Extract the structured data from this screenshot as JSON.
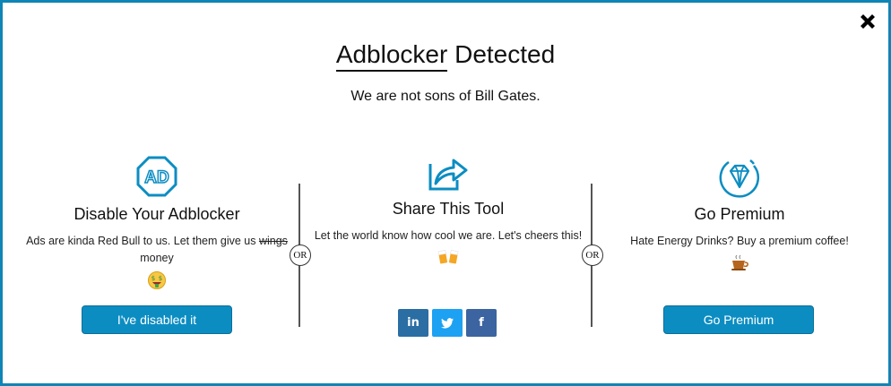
{
  "modal": {
    "title_part1": "Adblocker",
    "title_part2": " Detected",
    "subtitle": "We are not sons of Bill Gates."
  },
  "columns": [
    {
      "heading": "Disable Your Adblocker",
      "text_before": "Ads are kinda Red Bull to us. Let them give us ",
      "text_strike": "wings",
      "text_after": " money",
      "button_label": "I've disabled it",
      "icon": "ad-icon",
      "emoji": "money-face-emoji"
    },
    {
      "heading": "Share This Tool",
      "text": "Let the world know how cool we are. Let's cheers this!",
      "icon": "share-icon",
      "emoji": "beer-cheers-emoji",
      "social": [
        "in",
        "t",
        "f"
      ]
    },
    {
      "heading": "Go Premium",
      "text": "Hate Energy Drinks? Buy a premium coffee!",
      "button_label": "Go Premium",
      "icon": "diamond-icon",
      "emoji": "coffee-emoji"
    }
  ],
  "separators": {
    "or_label": "OR"
  },
  "colors": {
    "accent": "#0c8dc2",
    "border": "#0f85b5",
    "linkedin": "#2a6ea3",
    "twitter": "#1da1f2",
    "facebook": "#3b64a0"
  }
}
